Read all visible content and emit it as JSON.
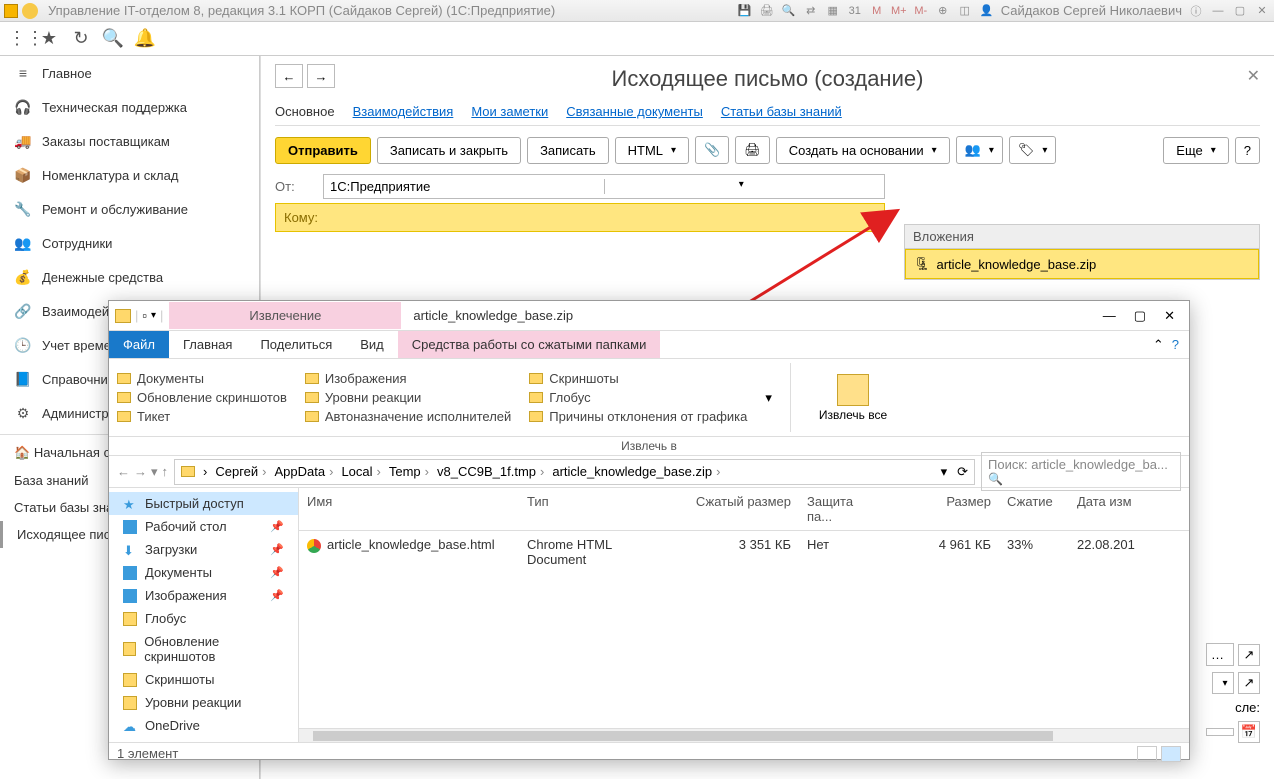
{
  "titlebar": {
    "title": "Управление IT-отделом 8, редакция 3.1 КОРП (Сайдаков Сергей)  (1С:Предприятие)",
    "user": "Сайдаков Сергей Николаевич",
    "m": "M",
    "mplus": "M+",
    "mminus": "M-",
    "cal": "31"
  },
  "sidebar": {
    "items": [
      {
        "icon": "home",
        "label": "Главное"
      },
      {
        "icon": "headset",
        "label": "Техническая поддержка"
      },
      {
        "icon": "truck",
        "label": "Заказы поставщикам"
      },
      {
        "icon": "box",
        "label": "Номенклатура и склад"
      },
      {
        "icon": "wrench",
        "label": "Ремонт и обслуживание"
      },
      {
        "icon": "users",
        "label": "Сотрудники"
      },
      {
        "icon": "money",
        "label": "Денежные средства"
      },
      {
        "icon": "link",
        "label": "Взаимодействия"
      },
      {
        "icon": "clock",
        "label": "Учет времени"
      },
      {
        "icon": "book",
        "label": "Справочники"
      },
      {
        "icon": "gear",
        "label": "Администрирование"
      }
    ],
    "subs": [
      {
        "icon": "home",
        "label": "Начальная страница"
      },
      {
        "label": "База знаний"
      },
      {
        "label": "Статьи базы знаний"
      },
      {
        "label": "Исходящее письмо",
        "active": true
      }
    ]
  },
  "page": {
    "title": "Исходящее письмо (создание)",
    "tabs": [
      "Основное",
      "Взаимодействия",
      "Мои заметки",
      "Связанные документы",
      "Статьи базы знаний"
    ],
    "active_tab": 0,
    "buttons": {
      "send": "Отправить",
      "save_close": "Записать и закрыть",
      "save": "Записать",
      "html": "HTML",
      "create_based": "Создать на основании",
      "more": "Еще"
    },
    "from_label": "От:",
    "from_value": "1С:Предприятие",
    "to_label": "Кому:",
    "attach_head": "Вложения",
    "attach_file": "article_knowledge_base.zip",
    "after_label": "сле:"
  },
  "explorer": {
    "extract_tab": "Извлечение",
    "archive_name": "article_knowledge_base.zip",
    "tabs": {
      "file": "Файл",
      "home": "Главная",
      "share": "Поделиться",
      "view": "Вид",
      "tools": "Средства работы со сжатыми папками"
    },
    "ribbon": {
      "col1": [
        "Документы",
        "Обновление скриншотов",
        "Тикет"
      ],
      "col2": [
        "Изображения",
        "Уровни реакции",
        "Автоназначение исполнителей"
      ],
      "col3": [
        "Скриншоты",
        "Глобус",
        "Причины отклонения от графика"
      ],
      "extract_all": "Извлечь все",
      "extract_to": "Извлечь в"
    },
    "breadcrumbs": [
      "Сергей",
      "AppData",
      "Local",
      "Temp",
      "v8_CC9B_1f.tmp",
      "article_knowledge_base.zip"
    ],
    "search_placeholder": "Поиск: article_knowledge_ba...",
    "sidebar": [
      {
        "label": "Быстрый доступ",
        "hl": true,
        "ic": "star"
      },
      {
        "label": "Рабочий стол",
        "pin": true,
        "ic": "desktop"
      },
      {
        "label": "Загрузки",
        "pin": true,
        "ic": "down"
      },
      {
        "label": "Документы",
        "pin": true,
        "ic": "doc"
      },
      {
        "label": "Изображения",
        "pin": true,
        "ic": "img"
      },
      {
        "label": "Глобус",
        "ic": "folder"
      },
      {
        "label": "Обновление скриншотов",
        "ic": "folder"
      },
      {
        "label": "Скриншоты",
        "ic": "folder"
      },
      {
        "label": "Уровни реакции",
        "ic": "folder"
      },
      {
        "label": "OneDrive",
        "ic": "cloud"
      }
    ],
    "columns": {
      "name": "Имя",
      "type": "Тип",
      "csize": "Сжатый размер",
      "prot": "Защита па...",
      "size": "Размер",
      "comp": "Сжатие",
      "date": "Дата изм"
    },
    "row": {
      "name": "article_knowledge_base.html",
      "type": "Chrome HTML Document",
      "csize": "3 351 КБ",
      "prot": "Нет",
      "size": "4 961 КБ",
      "comp": "33%",
      "date": "22.08.201"
    },
    "status": "1 элемент"
  }
}
